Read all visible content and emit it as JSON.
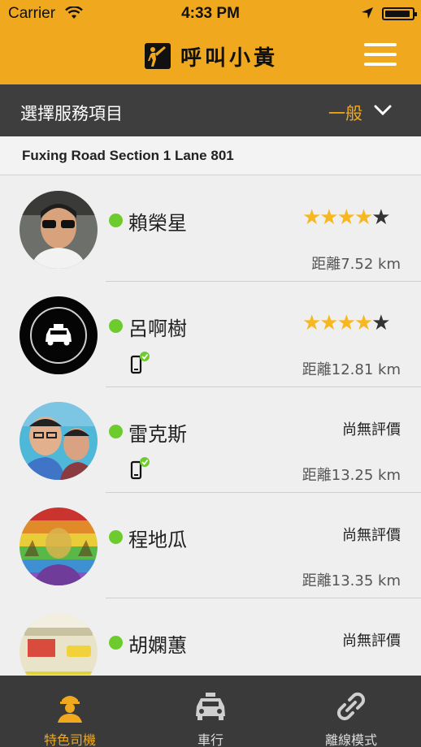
{
  "status_bar": {
    "carrier": "Carrier",
    "time": "4:33 PM"
  },
  "header": {
    "title": "呼叫小黃",
    "logo_icon": "taxi-hail-person-icon",
    "menu_icon": "hamburger-menu-icon"
  },
  "service": {
    "label": "選擇服務項目",
    "value": "一般",
    "chevron_icon": "chevron-down-icon"
  },
  "address": "Fuxing Road Section 1 Lane 801",
  "drivers": [
    {
      "name": "賴榮星",
      "rating": 4,
      "rating_text": "",
      "distance": "距離7.52 km",
      "phone_verified": false,
      "avatar": "photo"
    },
    {
      "name": "呂啊樹",
      "rating": 4,
      "rating_text": "",
      "distance": "距離12.81 km",
      "phone_verified": true,
      "avatar": "taxi-icon"
    },
    {
      "name": "雷克斯",
      "rating": 0,
      "rating_text": "尚無評價",
      "distance": "距離13.25 km",
      "phone_verified": true,
      "avatar": "photo"
    },
    {
      "name": "程地瓜",
      "rating": 0,
      "rating_text": "尚無評價",
      "distance": "距離13.35 km",
      "phone_verified": false,
      "avatar": "photo"
    },
    {
      "name": "胡嫻蕙",
      "rating": 0,
      "rating_text": "尚無評價",
      "distance": "",
      "phone_verified": true,
      "avatar": "photo"
    }
  ],
  "tabs": [
    {
      "label": "特色司機",
      "icon": "driver-icon",
      "active": true
    },
    {
      "label": "車行",
      "icon": "taxi-icon",
      "active": false
    },
    {
      "label": "離線模式",
      "icon": "link-icon",
      "active": false
    }
  ],
  "colors": {
    "accent": "#f0a91e",
    "dark_bar": "#3e3e3e",
    "online_dot": "#6ecb2e",
    "star": "#f6b81e"
  }
}
